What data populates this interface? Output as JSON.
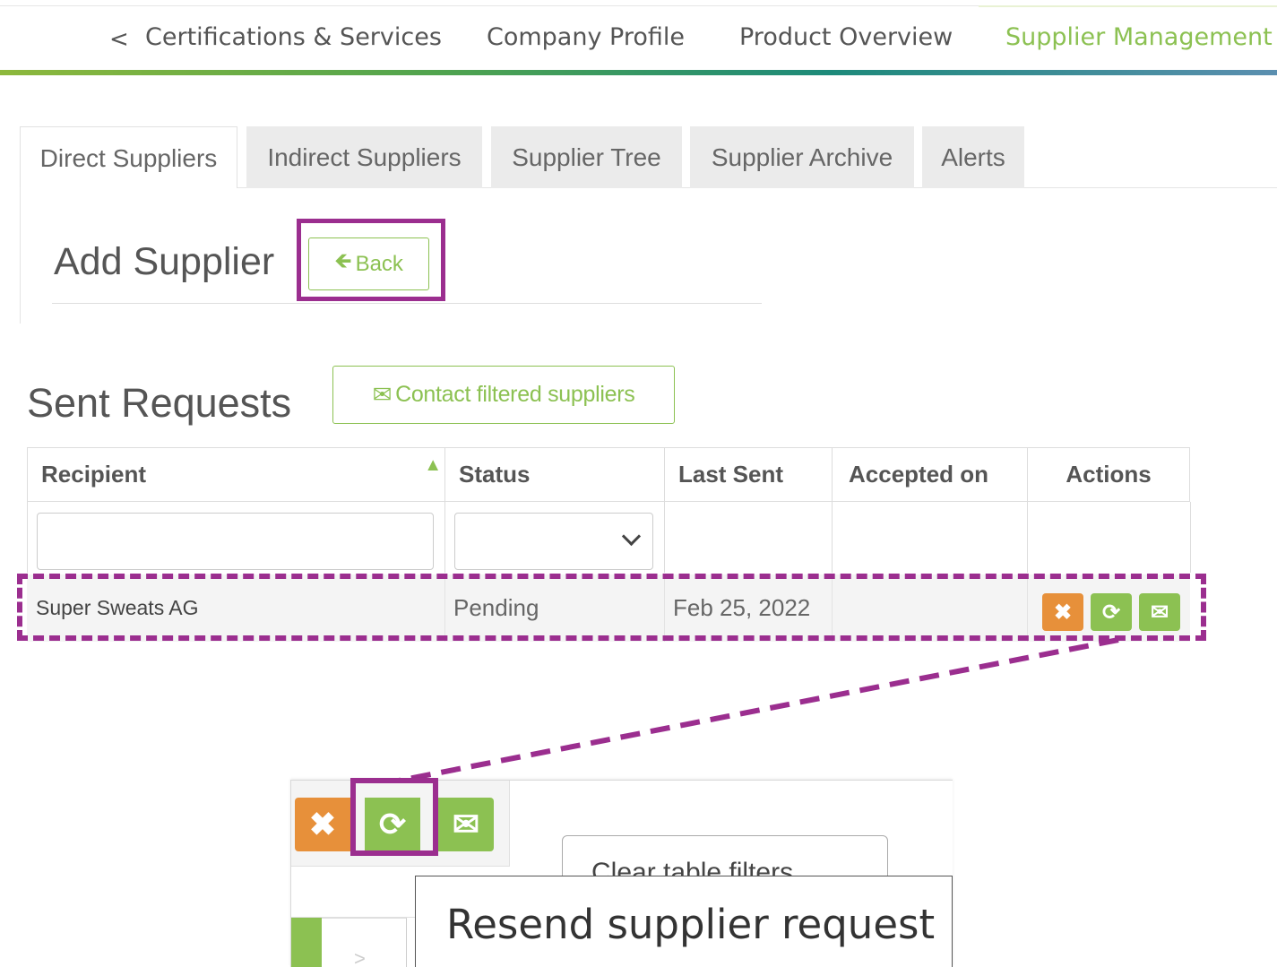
{
  "topnav": {
    "items": [
      "Certifications & Services",
      "Company Profile",
      "Product Overview",
      "Supplier Management"
    ],
    "active_index": 3
  },
  "tabs": [
    "Direct Suppliers",
    "Indirect Suppliers",
    "Supplier Tree",
    "Supplier Archive",
    "Alerts"
  ],
  "add_supplier": {
    "title": "Add Supplier",
    "back_label": "Back"
  },
  "sent_requests": {
    "title": "Sent Requests",
    "contact_label": "Contact filtered suppliers",
    "columns": [
      "Recipient",
      "Status",
      "Last Sent",
      "Accepted on",
      "Actions"
    ],
    "sorted_column": "Recipient",
    "sort_direction": "ascending",
    "rows": [
      {
        "recipient": "Super Sweats AG",
        "status": "Pending",
        "last_sent": "Feb 25, 2022",
        "accepted_on": ""
      }
    ]
  },
  "actions": {
    "delete_icon": "times-icon",
    "resend_icon": "refresh-icon",
    "contact_icon": "envelope-icon"
  },
  "zoom": {
    "clear_filters_label": "Clear table filters",
    "tooltip": "Resend supplier request"
  },
  "colors": {
    "accent_green": "#8cc152",
    "delete_orange": "#e7903a",
    "highlight_purple": "#9b2e8f"
  }
}
